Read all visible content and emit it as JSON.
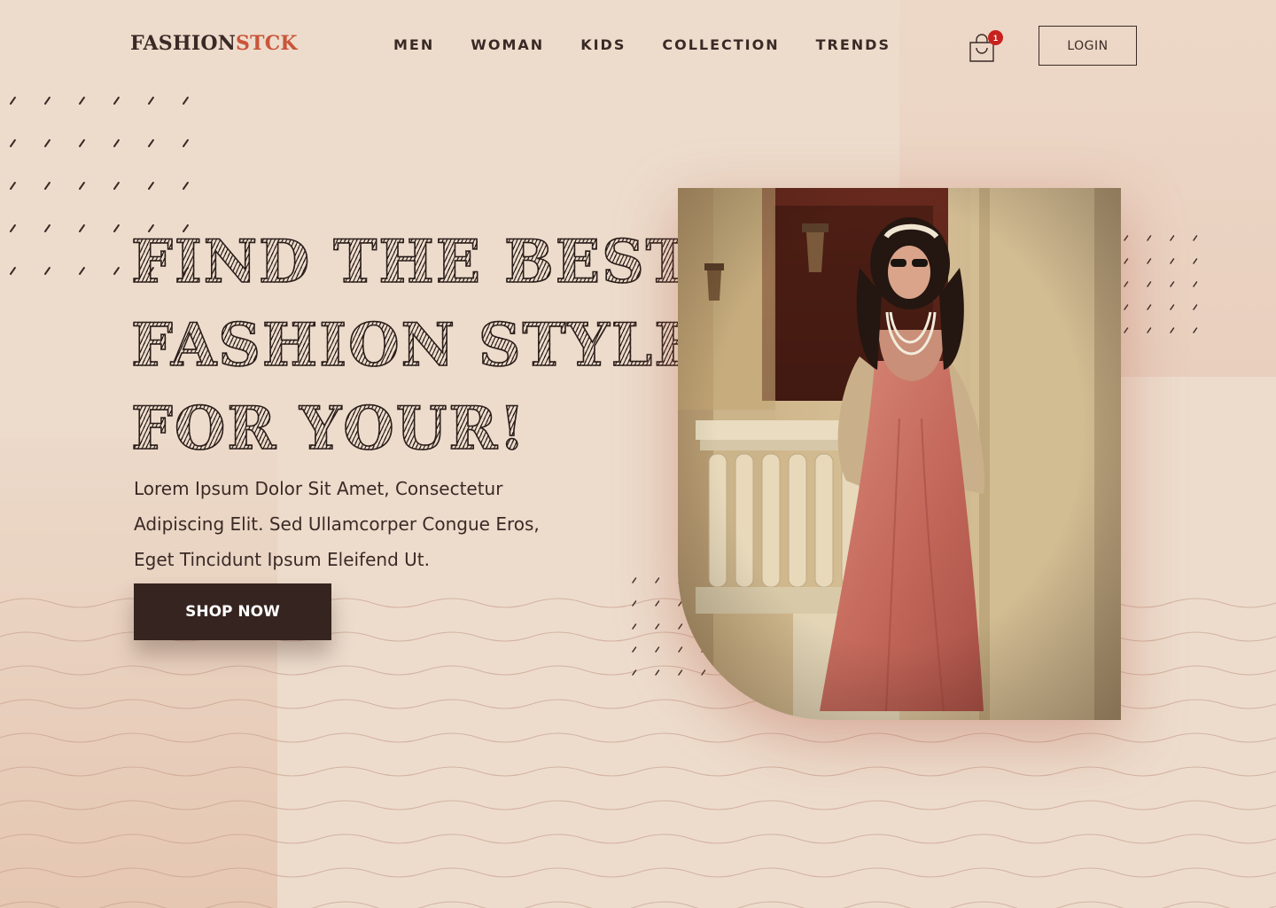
{
  "brand": {
    "part1": "FASHION",
    "part2": "STCK"
  },
  "nav": [
    {
      "label": "MEN"
    },
    {
      "label": "WOMAN"
    },
    {
      "label": "KIDS"
    },
    {
      "label": "COLLECTION"
    },
    {
      "label": "TRENDS"
    }
  ],
  "cart": {
    "count": "1",
    "icon": "shopping-bag-icon"
  },
  "login_label": "LOGIN",
  "hero": {
    "lines": [
      "FIND THE BEST",
      "FASHION STYLE",
      "FOR YOUR!"
    ],
    "description": "Lorem Ipsum Dolor Sit Amet, Consectetur Adipiscing Elit. Sed Ullamcorper Congue Eros, Eget Tincidunt Ipsum Eleifend Ut.",
    "cta_label": "SHOP NOW"
  },
  "colors": {
    "brand_accent": "#c9553a",
    "dark": "#35241f",
    "background": "#eddccc",
    "badge": "#c8221e"
  }
}
